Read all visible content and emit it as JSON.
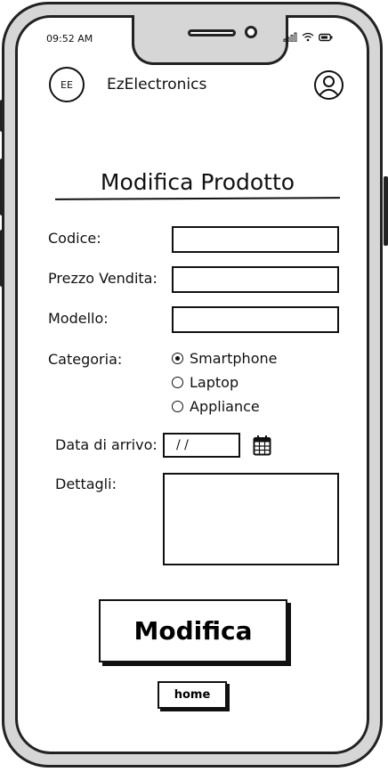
{
  "status_bar": {
    "time": "09:52 AM"
  },
  "header": {
    "logo_text": "EE",
    "app_name": "EzElectronics",
    "profile_icon": "user-circle-icon"
  },
  "page": {
    "title": "Modifica Prodotto"
  },
  "form": {
    "codice_label": "Codice:",
    "codice_value": "",
    "prezzo_label": "Prezzo Vendita:",
    "prezzo_value": "",
    "modello_label": "Modello:",
    "modello_value": "",
    "categoria_label": "Categoria:",
    "categories": [
      {
        "label": "Smartphone",
        "selected": true
      },
      {
        "label": "Laptop",
        "selected": false
      },
      {
        "label": "Appliance",
        "selected": false
      }
    ],
    "data_label": "Data di arrivo:",
    "data_value": "/ /",
    "calendar_icon": "calendar-icon",
    "dettagli_label": "Dettagli:",
    "dettagli_value": ""
  },
  "actions": {
    "submit_label": "Modifica",
    "home_label": "home"
  }
}
